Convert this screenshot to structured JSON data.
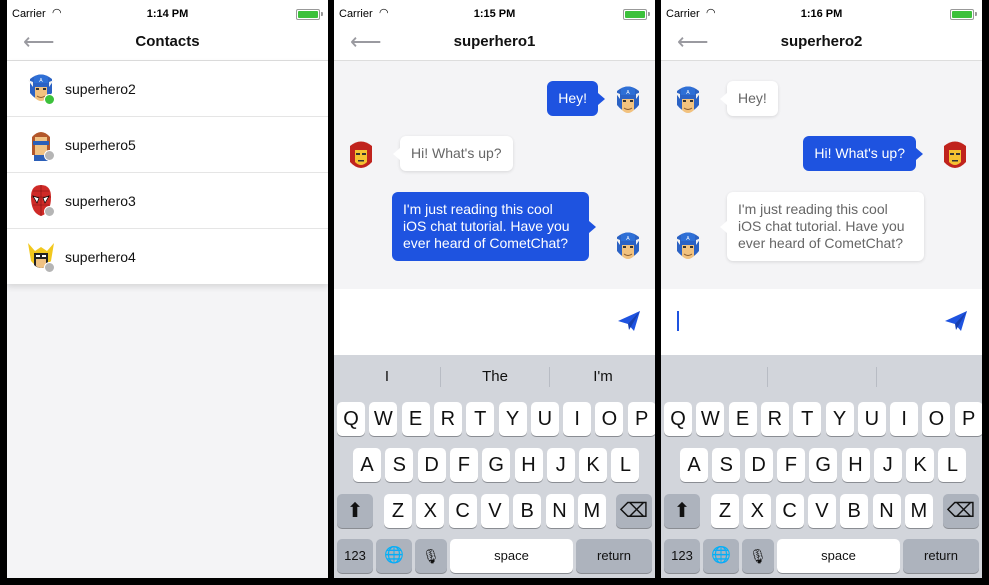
{
  "status": [
    {
      "carrier": "Carrier",
      "time": "1:14 PM"
    },
    {
      "carrier": "Carrier",
      "time": "1:15 PM"
    },
    {
      "carrier": "Carrier",
      "time": "1:16 PM"
    }
  ],
  "screen1": {
    "title": "Contacts",
    "contacts": [
      {
        "name": "superhero2",
        "online": true
      },
      {
        "name": "superhero5",
        "online": false
      },
      {
        "name": "superhero3",
        "online": false
      },
      {
        "name": "superhero4",
        "online": false
      }
    ]
  },
  "screen2": {
    "title": "superhero1",
    "messages": [
      {
        "text": "Hey!",
        "from": "me"
      },
      {
        "text": "Hi! What's up?",
        "from": "them"
      },
      {
        "text": "I'm just reading this cool iOS chat tutorial. Have you ever heard of CometChat?",
        "from": "me"
      }
    ]
  },
  "screen3": {
    "title": "superhero2",
    "messages": [
      {
        "text": "Hey!",
        "from": "them"
      },
      {
        "text": "Hi! What's up?",
        "from": "me"
      },
      {
        "text": "I'm just reading this cool iOS chat tutorial. Have you ever heard of CometChat?",
        "from": "them"
      }
    ]
  },
  "keyboard": {
    "suggestions": [
      [
        "I",
        "The",
        "I'm"
      ],
      [
        "",
        "",
        ""
      ]
    ],
    "row1": [
      "Q",
      "W",
      "E",
      "R",
      "T",
      "Y",
      "U",
      "I",
      "O",
      "P"
    ],
    "row2": [
      "A",
      "S",
      "D",
      "F",
      "G",
      "H",
      "J",
      "K",
      "L"
    ],
    "row3": [
      "Z",
      "X",
      "C",
      "V",
      "B",
      "N",
      "M"
    ],
    "numbers_label": "123",
    "space_label": "space",
    "return_label": "return"
  },
  "colors": {
    "accent": "#1e53e0",
    "online": "#3cc13b",
    "offline": "#b5b5b5"
  }
}
